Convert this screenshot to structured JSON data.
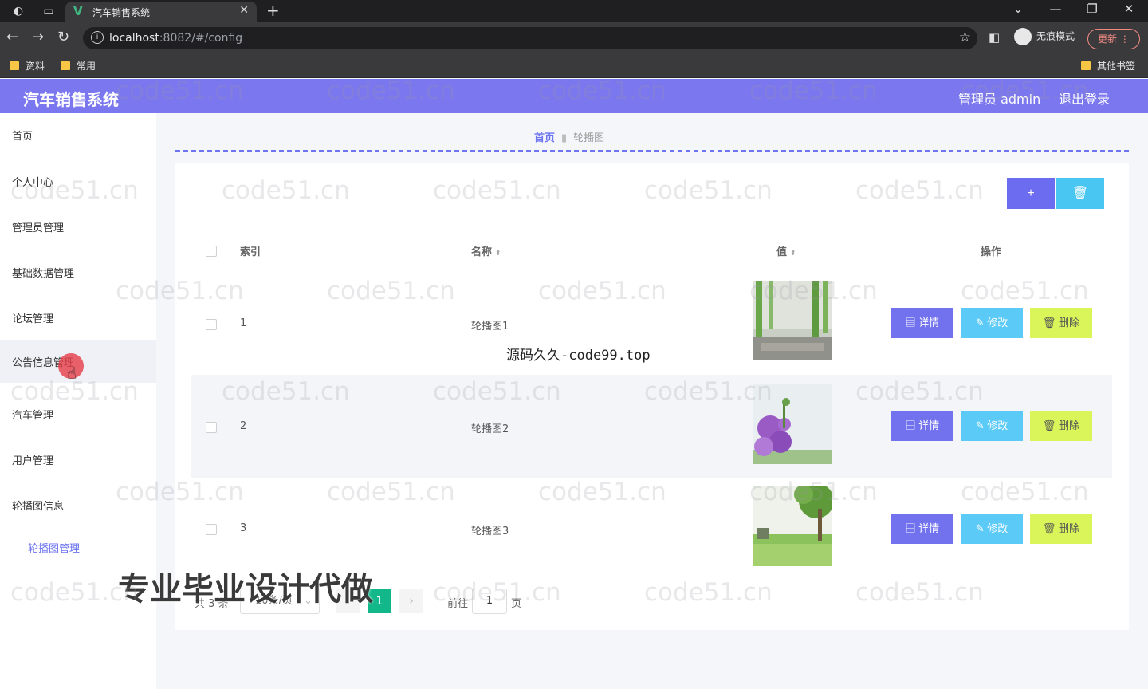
{
  "browser": {
    "tab_title": "汽车销售系统",
    "tab_close": "✕",
    "new_tab": "+",
    "url_host": "localhost",
    "url_rest": ":8082/#/config",
    "incognito_label": "无痕模式",
    "update_label": "更新",
    "bookmarks": [
      "资料",
      "常用"
    ],
    "other_bookmarks": "其他书签"
  },
  "header": {
    "title": "汽车销售系统",
    "user": "管理员 admin",
    "logout": "退出登录"
  },
  "sidebar": {
    "items": [
      "首页",
      "个人中心",
      "管理员管理",
      "基础数据管理",
      "论坛管理",
      "公告信息管理",
      "汽车管理",
      "用户管理",
      "轮播图信息"
    ],
    "submenu": "轮播图管理"
  },
  "breadcrumb": {
    "home": "首页",
    "current": "轮播图"
  },
  "toolbar": {
    "add_icon": "+",
    "delete_icon": "🗑"
  },
  "table": {
    "headers": {
      "index": "索引",
      "name": "名称",
      "value": "值",
      "actions": "操作"
    },
    "rows": [
      {
        "index": "1",
        "name": "轮播图1",
        "image": "bamboo-image"
      },
      {
        "index": "2",
        "name": "轮播图2",
        "image": "flower-image"
      },
      {
        "index": "3",
        "name": "轮播图3",
        "image": "tree-image"
      }
    ],
    "actions": {
      "detail": "详情",
      "edit": "修改",
      "remove": "删除"
    }
  },
  "pagination": {
    "total": "共 3 条",
    "page_size": "10条/页",
    "current": "1",
    "goto": "前往",
    "goto_value": "1",
    "page_suffix": "页",
    "prev": "‹",
    "next": "›"
  },
  "overlays": {
    "source_text": "源码久久-code99.top",
    "promo_text": "专业毕业设计代做",
    "watermark": "code51.cn"
  },
  "colors": {
    "header": "#7b78ef",
    "accent": "#6c74f0",
    "detail_button": "#7272ee",
    "edit_button": "#5ccaf6",
    "remove_button": "#d9f55a",
    "page_active": "#13b88a"
  }
}
